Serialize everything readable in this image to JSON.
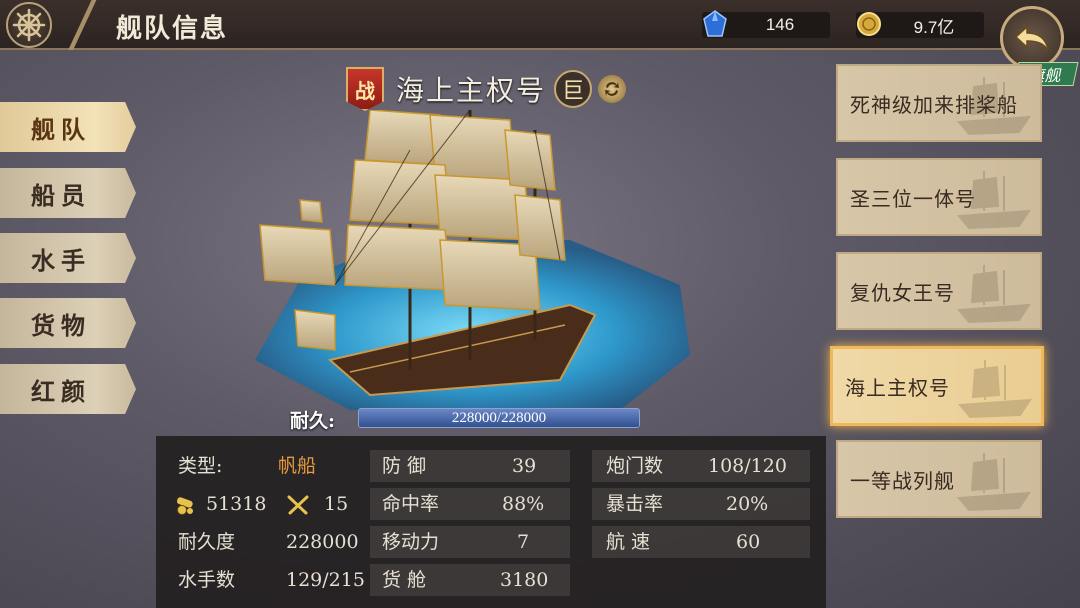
{
  "header": {
    "title": "舰队信息",
    "gems": "146",
    "gold": "9.7亿"
  },
  "nav": [
    "舰队",
    "船员",
    "水手",
    "货物",
    "红颜"
  ],
  "ship": {
    "badge": "战",
    "name": "海上主权号",
    "size_badge": "巨",
    "durability_label": "耐久:",
    "durability_text": "228000/228000",
    "durability_fraction": 1.0
  },
  "stats": {
    "type_label": "类型:",
    "type_value": "帆船",
    "cannon_count": "51318",
    "cannon_level": "15",
    "durability_label": "耐久度",
    "durability_value": "228000",
    "sailors_label": "水手数",
    "sailors_value": "129/215",
    "defense_label": "防 御",
    "defense_value": "39",
    "hit_label": "命中率",
    "hit_value": "88%",
    "move_label": "移动力",
    "move_value": "7",
    "cargo_label": "货 舱",
    "cargo_value": "3180",
    "gunport_label": "炮门数",
    "gunport_value": "108/120",
    "crit_label": "暴击率",
    "crit_value": "20%",
    "speed_label": "航 速",
    "speed_value": "60"
  },
  "fleet": {
    "flagship_tag": "旗舰",
    "ships": [
      "死神级加来排桨船",
      "圣三位一体号",
      "复仇女王号",
      "海上主权号",
      "一等战列舰"
    ],
    "active_index": 3
  },
  "colors": {
    "accent_gold": "#e89a3a",
    "active_card_glow": "#f2b44a",
    "war_badge_red": "#c7362a"
  }
}
